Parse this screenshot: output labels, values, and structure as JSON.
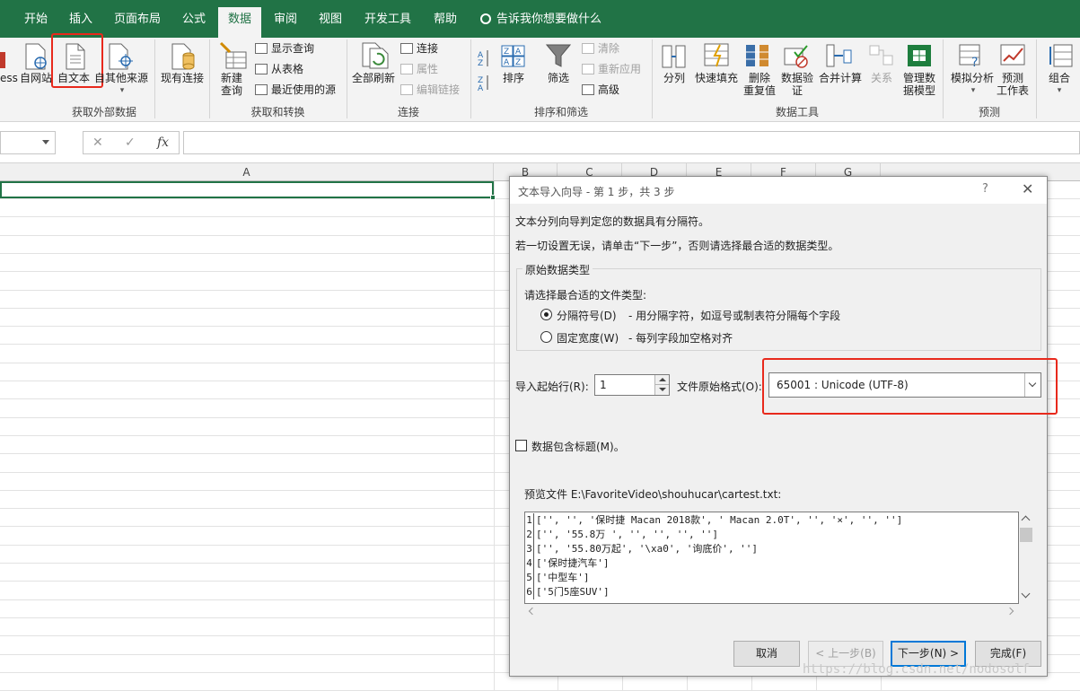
{
  "tabs": [
    "开始",
    "插入",
    "页面布局",
    "公式",
    "数据",
    "审阅",
    "视图",
    "开发工具",
    "帮助"
  ],
  "active_tab": "数据",
  "tell_me": "告诉我你想要做什么",
  "ribbon": {
    "get_external": {
      "label": "获取外部数据",
      "access_partial": "ess",
      "from_web": "自网站",
      "from_text": "自文本",
      "from_other": "自其他来源",
      "existing": "现有连接"
    },
    "get_transform": {
      "label": "获取和转换",
      "new_query": "新建\n查询",
      "show_queries": "显示查询",
      "from_table": "从表格",
      "recent_sources": "最近使用的源"
    },
    "connections": {
      "label": "连接",
      "refresh_all": "全部刷新",
      "connections": "连接",
      "properties": "属性",
      "edit_links": "编辑链接"
    },
    "sort_filter": {
      "label": "排序和筛选",
      "sort": "排序",
      "filter": "筛选",
      "clear": "清除",
      "reapply": "重新应用",
      "advanced": "高级"
    },
    "data_tools": {
      "label": "数据工具",
      "split": "分列",
      "flash_fill": "快速填充",
      "remove_dup": "删除\n重复值",
      "validation": "数据验\n证",
      "consolidate": "合并计算",
      "relations": "关系",
      "manage_model": "管理数\n据模型"
    },
    "forecast": {
      "label": "预测",
      "what_if": "模拟分析",
      "forecast_sheet": "预测\n工作表"
    },
    "outline": {
      "group": "组合"
    }
  },
  "formula_bar": {
    "cancel": "✕",
    "enter": "✓",
    "fx": "fx"
  },
  "columns": [
    "A",
    "B",
    "C",
    "D",
    "E",
    "F",
    "G"
  ],
  "dialog": {
    "title": "文本导入向导 - 第 1 步，共 3 步",
    "help": "?",
    "close": "✕",
    "line1": "文本分列向导判定您的数据具有分隔符。",
    "line2": "若一切设置无误，请单击“下一步”，否则请选择最合适的数据类型。",
    "group_title": "原始数据类型",
    "choose_type": "请选择最合适的文件类型:",
    "opt_delimited": "分隔符号(D)",
    "opt_delimited_desc": "- 用分隔字符，如逗号或制表符分隔每个字段",
    "opt_fixed": "固定宽度(W)",
    "opt_fixed_desc": "- 每列字段加空格对齐",
    "start_row_label": "导入起始行(R):",
    "start_row_value": "1",
    "origin_label": "文件原始格式(O):",
    "origin_value": "65001 : Unicode (UTF-8)",
    "headers_label": "数据包含标题(M)。",
    "preview_label": "预览文件 E:\\FavoriteVideo\\shouhucar\\cartest.txt:",
    "preview_rows": [
      {
        "n": "1",
        "text": "['', '', '保时捷 Macan 2018款', ' Macan 2.0T', '', '×', '', '']"
      },
      {
        "n": "2",
        "text": "['', '55.8万 ', '', '', '', '']"
      },
      {
        "n": "3",
        "text": "['', '55.80万起', '\\xa0', '询底价', '']"
      },
      {
        "n": "4",
        "text": "['保时捷汽车']"
      },
      {
        "n": "5",
        "text": "['中型车']"
      },
      {
        "n": "6",
        "text": "['5门5座SUV']"
      }
    ],
    "btn_cancel": "取消",
    "btn_back": "< 上一步(B)",
    "btn_next": "下一步(N) >",
    "btn_finish": "完成(F)"
  },
  "watermark": "https://blog.csdn.net/nodosolf",
  "colors": {
    "excel_green": "#217346",
    "highlight_red": "#e8291c",
    "default_button_blue": "#0078d7"
  }
}
